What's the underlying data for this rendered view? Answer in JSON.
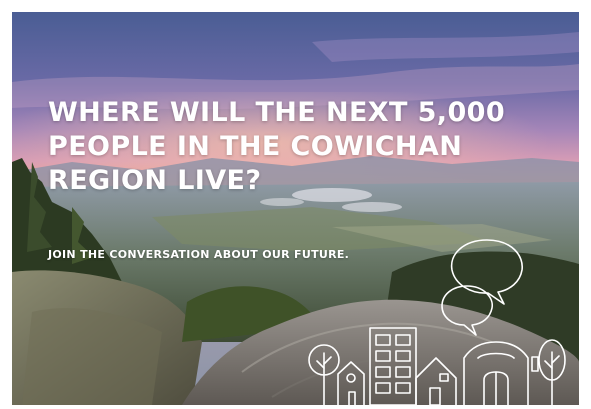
{
  "headline": {
    "line1": "WHERE WILL THE NEXT 5,000",
    "line2": "PEOPLE IN THE COWICHAN",
    "line3": "REGION LIVE?"
  },
  "tagline": {
    "prefix": "JOIN THE CONVERSATION ABOUT ",
    "emphasis": "OUR FUTURE."
  },
  "colors": {
    "text": "#ffffff",
    "sky_top": "#4a5d94",
    "sky_pink": "#c990b8",
    "horizon_glow": "#f2a98f"
  },
  "icons": [
    "speech-bubble-icon",
    "house-icon",
    "apartment-building-icon",
    "tree-icon",
    "barn-icon"
  ]
}
